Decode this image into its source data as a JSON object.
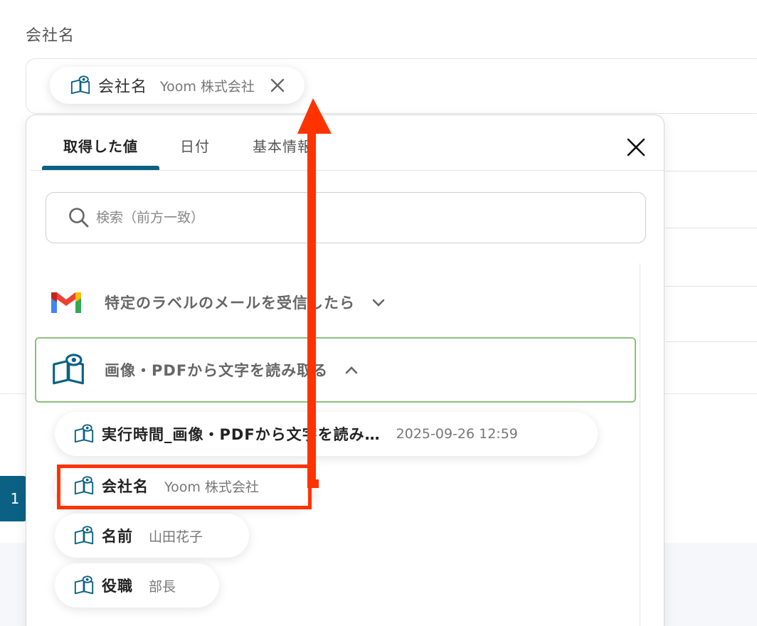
{
  "field": {
    "label": "会社名",
    "chip": {
      "name": "会社名",
      "value": "Yoom 株式会社"
    }
  },
  "background": {
    "button_label": "1"
  },
  "popup": {
    "tabs": [
      "取得した値",
      "日付",
      "基本情報"
    ],
    "search_placeholder": "検索（前方一致）",
    "sections": [
      {
        "title": "特定のラベルのメールを受信したら",
        "icon": "gmail-icon",
        "expanded": false
      },
      {
        "title": "画像・PDFから文字を読み取る",
        "icon": "ocr-book-icon",
        "expanded": true
      }
    ],
    "items": [
      {
        "name": "実行時間_画像・PDFから文字を読み…",
        "value": "2025-09-26 12:59"
      },
      {
        "name": "会社名",
        "value": "Yoom 株式会社"
      },
      {
        "name": "名前",
        "value": "山田花子"
      },
      {
        "name": "役職",
        "value": "部長"
      }
    ]
  },
  "colors": {
    "accent": "#0b6183",
    "highlight": "#ff3300",
    "section_border": "#8bc17a"
  }
}
